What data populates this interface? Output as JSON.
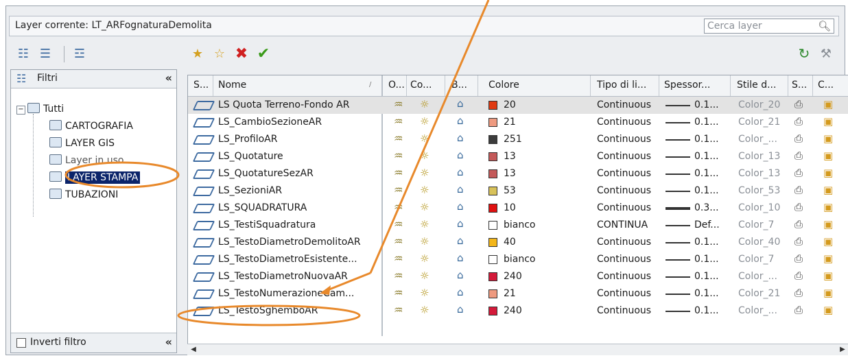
{
  "header": {
    "current_layer": "Layer corrente: LT_ARFognaturaDemolita",
    "search_placeholder": "Cerca layer"
  },
  "filters": {
    "title": "Filtri",
    "collapse": "«",
    "root": "Tutti",
    "items": [
      "CARTOGRAFIA",
      "LAYER GIS",
      "Layer in uso",
      "LAYER STAMPA",
      "TUBAZIONI"
    ],
    "selected": "LAYER STAMPA",
    "invert_label": "Inverti filtro",
    "footer_collapse": "«"
  },
  "columns": [
    "S...",
    "Nome",
    "O...",
    "Co...",
    "B...",
    "Colore",
    "Tipo di li...",
    "Spessor...",
    "Stile d...",
    "S...",
    "C..."
  ],
  "layers": [
    {
      "name": "LS Quota Terreno-Fondo AR",
      "color_value": "20",
      "color_hex": "#e03a12",
      "linetype": "Continuous",
      "lineweight": "0.1...",
      "plot_style": "Color_20",
      "selected": true
    },
    {
      "name": "LS_CambioSezioneAR",
      "color_value": "21",
      "color_hex": "#ee9a80",
      "linetype": "Continuous",
      "lineweight": "0.1...",
      "plot_style": "Color_21"
    },
    {
      "name": "LS_ProfiloAR",
      "color_value": "251",
      "color_hex": "#3c3c3c",
      "linetype": "Continuous",
      "lineweight": "0.1...",
      "plot_style": "Color_..."
    },
    {
      "name": "LS_Quotature",
      "color_value": "13",
      "color_hex": "#c45a5a",
      "linetype": "Continuous",
      "lineweight": "0.1...",
      "plot_style": "Color_13"
    },
    {
      "name": "LS_QuotatureSezAR",
      "color_value": "13",
      "color_hex": "#c45a5a",
      "linetype": "Continuous",
      "lineweight": "0.1...",
      "plot_style": "Color_13"
    },
    {
      "name": "LS_SezioniAR",
      "color_value": "53",
      "color_hex": "#d8c25a",
      "linetype": "Continuous",
      "lineweight": "0.1...",
      "plot_style": "Color_53"
    },
    {
      "name": "LS_SQUADRATURA",
      "color_value": "10",
      "color_hex": "#e01010",
      "linetype": "Continuous",
      "lineweight": "0.3...",
      "plot_style": "Color_10",
      "thick": true
    },
    {
      "name": "LS_TestiSquadratura",
      "color_value": "bianco",
      "color_hex": "#ffffff",
      "linetype": "CONTINUA",
      "lineweight": "Def...",
      "plot_style": "Color_7"
    },
    {
      "name": "LS_TestoDiametroDemolitoAR",
      "color_value": "40",
      "color_hex": "#f3b61a",
      "linetype": "Continuous",
      "lineweight": "0.1...",
      "plot_style": "Color_40"
    },
    {
      "name": "LS_TestoDiametroEsistente...",
      "color_value": "bianco",
      "color_hex": "#ffffff",
      "linetype": "Continuous",
      "lineweight": "0.1...",
      "plot_style": "Color_7"
    },
    {
      "name": "LS_TestoDiametroNuovaAR",
      "color_value": "240",
      "color_hex": "#d41a3a",
      "linetype": "Continuous",
      "lineweight": "0.1...",
      "plot_style": "Color_..."
    },
    {
      "name": "LS_TestoNumerazioneCam...",
      "color_value": "21",
      "color_hex": "#ee9a80",
      "linetype": "Continuous",
      "lineweight": "0.1...",
      "plot_style": "Color_21"
    },
    {
      "name": "LS_TestoSghemboAR",
      "color_value": "240",
      "color_hex": "#d41a3a",
      "linetype": "Continuous",
      "lineweight": "0.1...",
      "plot_style": "Color_..."
    }
  ],
  "annotation_color": "#e8892b"
}
